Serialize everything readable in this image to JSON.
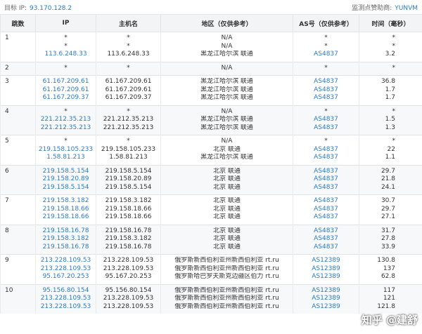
{
  "header": {
    "target_label": "目标 IP:",
    "target_ip": "93.170.128.2",
    "sponsor_label": "监测点赞助商:",
    "sponsor": "YUNVM"
  },
  "columns": [
    "跳数",
    "IP",
    "主机名",
    "地区（仅供参考）",
    "AS号（仅供参考）",
    "时间（毫秒）"
  ],
  "rows": [
    {
      "hop": "1",
      "ip": [
        "*",
        "*",
        "113.6.248.33"
      ],
      "host": [
        "*",
        "*",
        "113.6.248.33"
      ],
      "region": [
        "N/A",
        "N/A",
        "黑龙江哈尔滨 联通"
      ],
      "as": [
        "*",
        "*",
        "AS4837"
      ],
      "ms": [
        "*",
        "*",
        "3.2"
      ]
    },
    {
      "hop": "2",
      "ip": [
        "*"
      ],
      "host": [
        "*"
      ],
      "region": [
        "N/A"
      ],
      "as": [
        "*"
      ],
      "ms": [
        "*"
      ]
    },
    {
      "hop": "3",
      "ip": [
        "61.167.209.61",
        "61.167.209.61",
        "61.167.209.37"
      ],
      "host": [
        "61.167.209.61",
        "61.167.209.61",
        "61.167.209.37"
      ],
      "region": [
        "黑龙江哈尔滨 联通",
        "黑龙江哈尔滨 联通",
        "黑龙江哈尔滨 联通"
      ],
      "as": [
        "AS4837",
        "AS4837",
        "AS4837"
      ],
      "ms": [
        "36.8",
        "1.7",
        "1.7"
      ]
    },
    {
      "hop": "4",
      "ip": [
        "*",
        "221.212.35.213",
        "221.212.35.213"
      ],
      "host": [
        "*",
        "221.212.35.213",
        "221.212.35.213"
      ],
      "region": [
        "N/A",
        "黑龙江哈尔滨 联通",
        "黑龙江哈尔滨 联通"
      ],
      "as": [
        "*",
        "AS4837",
        "AS4837"
      ],
      "ms": [
        "*",
        "1.5",
        "1.3"
      ]
    },
    {
      "hop": "5",
      "ip": [
        "*",
        "219.158.105.233",
        "1.58.81.213"
      ],
      "host": [
        "*",
        "219.158.105.233",
        "1.58.81.213"
      ],
      "region": [
        "N/A",
        "北京 联通",
        "黑龙江哈尔滨 联通"
      ],
      "as": [
        "*",
        "AS4837",
        "AS4837"
      ],
      "ms": [
        "*",
        "22",
        "1.1"
      ]
    },
    {
      "hop": "6",
      "ip": [
        "219.158.5.154",
        "219.158.20.89",
        "219.158.5.154"
      ],
      "host": [
        "219.158.5.154",
        "219.158.20.89",
        "219.158.5.154"
      ],
      "region": [
        "北京 联通",
        "北京 联通",
        "北京 联通"
      ],
      "as": [
        "AS4837",
        "AS4837",
        "AS4837"
      ],
      "ms": [
        "29.7",
        "21.8",
        "24.1"
      ]
    },
    {
      "hop": "7",
      "ip": [
        "219.158.3.182",
        "219.158.18.66",
        "219.158.18.66"
      ],
      "host": [
        "219.158.3.182",
        "219.158.18.66",
        "219.158.18.66"
      ],
      "region": [
        "北京 联通",
        "北京 联通",
        "北京 联通"
      ],
      "as": [
        "AS4837",
        "AS4837",
        "AS4837"
      ],
      "ms": [
        "30.7",
        "29.7",
        "27.1"
      ]
    },
    {
      "hop": "8",
      "ip": [
        "219.158.16.78",
        "219.158.3.182",
        "219.158.16.78"
      ],
      "host": [
        "219.158.16.78",
        "219.158.3.182",
        "219.158.16.78"
      ],
      "region": [
        "北京 联通",
        "北京 联通",
        "北京 联通"
      ],
      "as": [
        "AS4837",
        "AS4837",
        "AS4837"
      ],
      "ms": [
        "31.7",
        "27.8",
        "33.9"
      ]
    },
    {
      "hop": "9",
      "ip": [
        "213.228.109.53",
        "213.228.109.53",
        "95.167.20.253"
      ],
      "host": [
        "213.228.109.53",
        "213.228.109.53",
        "95.167.20.253"
      ],
      "region": [
        "俄罗斯新西伯利亚州新西伯利亚 rt.ru",
        "俄罗斯新西伯利亚州新西伯利亚 rt.ru",
        "俄罗斯哈巴罗夫斯克边疆区伯力 rt.ru"
      ],
      "as": [
        "AS12389",
        "AS12389",
        "AS12389"
      ],
      "ms": [
        "130.8",
        "137",
        "62.8"
      ]
    },
    {
      "hop": "10",
      "ip": [
        "95.156.80.154",
        "213.228.109.53",
        "213.228.109.53"
      ],
      "host": [
        "95.156.80.154",
        "213.228.109.53",
        "213.228.109.53"
      ],
      "region": [
        "俄罗斯新西伯利亚州新西伯利亚 rt.ru",
        "俄罗斯新西伯利亚州新西伯利亚 rt.ru",
        "俄罗斯新西伯利亚州新西伯利亚 rt.ru"
      ],
      "as": [
        "AS12389",
        "AS12389",
        "AS12389"
      ],
      "ms": [
        "117",
        "121",
        "121.8"
      ]
    }
  ],
  "watermark": "知乎 @建舒",
  "colors": {
    "link": "#2b7bc7",
    "header_bg": "#f2f4f6",
    "alt_row_bg": "#f6f8fa"
  }
}
